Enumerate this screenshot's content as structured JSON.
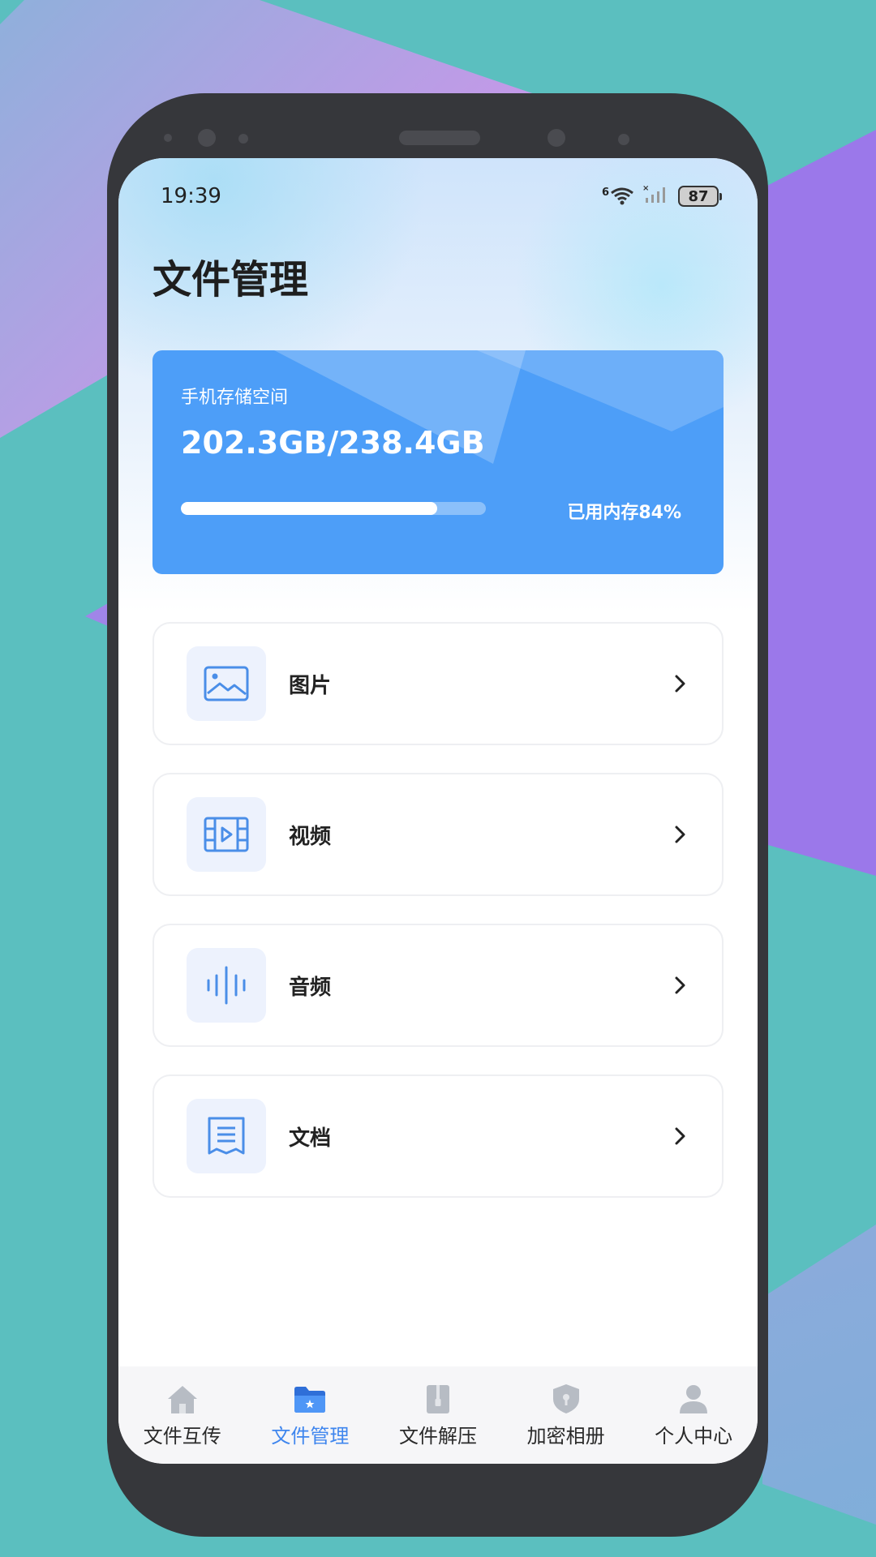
{
  "status_bar": {
    "time": "19:39",
    "network_badge": "6",
    "battery": "87"
  },
  "page": {
    "title": "文件管理"
  },
  "storage": {
    "label": "手机存储空间",
    "value": "202.3GB/238.4GB",
    "used_text": "已用内存84%",
    "used_fraction": 0.84
  },
  "categories": [
    {
      "label": "图片",
      "icon": "image-icon"
    },
    {
      "label": "视频",
      "icon": "video-icon"
    },
    {
      "label": "音频",
      "icon": "audio-icon"
    },
    {
      "label": "文档",
      "icon": "document-icon"
    }
  ],
  "tabs": [
    {
      "label": "文件互传",
      "icon": "home-icon",
      "active": false
    },
    {
      "label": "文件管理",
      "icon": "folder-icon",
      "active": true
    },
    {
      "label": "文件解压",
      "icon": "zip-icon",
      "active": false
    },
    {
      "label": "加密相册",
      "icon": "shield-icon",
      "active": false
    },
    {
      "label": "个人中心",
      "icon": "user-icon",
      "active": false
    }
  ],
  "colors": {
    "accent": "#3f86ee",
    "card": "#4d9ef8",
    "icon_blue": "#4a8ee8",
    "icon_bg": "#edf2fd",
    "background": "#5bbfbf"
  }
}
